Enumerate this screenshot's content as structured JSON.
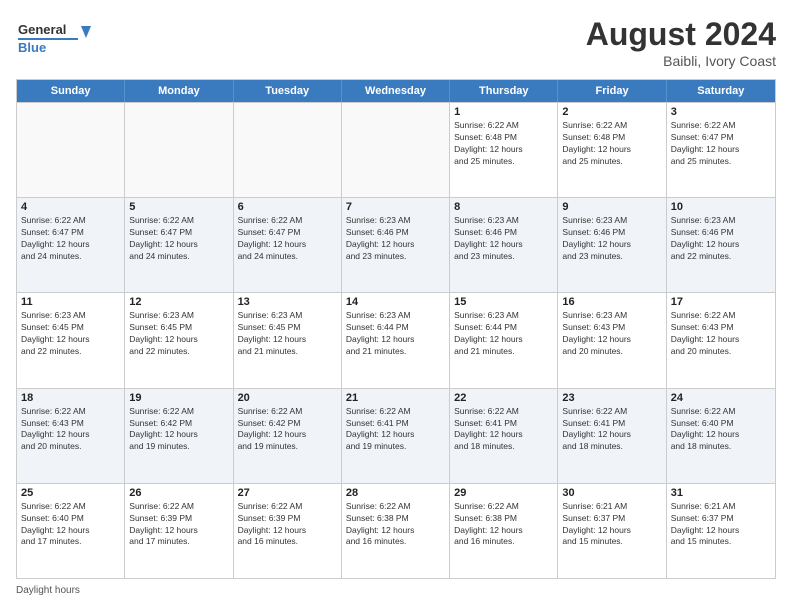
{
  "header": {
    "logo_line1": "General",
    "logo_line2": "Blue",
    "month_year": "August 2024",
    "location": "Baibli, Ivory Coast"
  },
  "calendar": {
    "days_of_week": [
      "Sunday",
      "Monday",
      "Tuesday",
      "Wednesday",
      "Thursday",
      "Friday",
      "Saturday"
    ],
    "rows": [
      [
        {
          "day": "",
          "info": "",
          "empty": true
        },
        {
          "day": "",
          "info": "",
          "empty": true
        },
        {
          "day": "",
          "info": "",
          "empty": true
        },
        {
          "day": "",
          "info": "",
          "empty": true
        },
        {
          "day": "1",
          "info": "Sunrise: 6:22 AM\nSunset: 6:48 PM\nDaylight: 12 hours\nand 25 minutes."
        },
        {
          "day": "2",
          "info": "Sunrise: 6:22 AM\nSunset: 6:48 PM\nDaylight: 12 hours\nand 25 minutes."
        },
        {
          "day": "3",
          "info": "Sunrise: 6:22 AM\nSunset: 6:47 PM\nDaylight: 12 hours\nand 25 minutes."
        }
      ],
      [
        {
          "day": "4",
          "info": "Sunrise: 6:22 AM\nSunset: 6:47 PM\nDaylight: 12 hours\nand 24 minutes."
        },
        {
          "day": "5",
          "info": "Sunrise: 6:22 AM\nSunset: 6:47 PM\nDaylight: 12 hours\nand 24 minutes."
        },
        {
          "day": "6",
          "info": "Sunrise: 6:22 AM\nSunset: 6:47 PM\nDaylight: 12 hours\nand 24 minutes."
        },
        {
          "day": "7",
          "info": "Sunrise: 6:23 AM\nSunset: 6:46 PM\nDaylight: 12 hours\nand 23 minutes."
        },
        {
          "day": "8",
          "info": "Sunrise: 6:23 AM\nSunset: 6:46 PM\nDaylight: 12 hours\nand 23 minutes."
        },
        {
          "day": "9",
          "info": "Sunrise: 6:23 AM\nSunset: 6:46 PM\nDaylight: 12 hours\nand 23 minutes."
        },
        {
          "day": "10",
          "info": "Sunrise: 6:23 AM\nSunset: 6:46 PM\nDaylight: 12 hours\nand 22 minutes."
        }
      ],
      [
        {
          "day": "11",
          "info": "Sunrise: 6:23 AM\nSunset: 6:45 PM\nDaylight: 12 hours\nand 22 minutes."
        },
        {
          "day": "12",
          "info": "Sunrise: 6:23 AM\nSunset: 6:45 PM\nDaylight: 12 hours\nand 22 minutes."
        },
        {
          "day": "13",
          "info": "Sunrise: 6:23 AM\nSunset: 6:45 PM\nDaylight: 12 hours\nand 21 minutes."
        },
        {
          "day": "14",
          "info": "Sunrise: 6:23 AM\nSunset: 6:44 PM\nDaylight: 12 hours\nand 21 minutes."
        },
        {
          "day": "15",
          "info": "Sunrise: 6:23 AM\nSunset: 6:44 PM\nDaylight: 12 hours\nand 21 minutes."
        },
        {
          "day": "16",
          "info": "Sunrise: 6:23 AM\nSunset: 6:43 PM\nDaylight: 12 hours\nand 20 minutes."
        },
        {
          "day": "17",
          "info": "Sunrise: 6:22 AM\nSunset: 6:43 PM\nDaylight: 12 hours\nand 20 minutes."
        }
      ],
      [
        {
          "day": "18",
          "info": "Sunrise: 6:22 AM\nSunset: 6:43 PM\nDaylight: 12 hours\nand 20 minutes."
        },
        {
          "day": "19",
          "info": "Sunrise: 6:22 AM\nSunset: 6:42 PM\nDaylight: 12 hours\nand 19 minutes."
        },
        {
          "day": "20",
          "info": "Sunrise: 6:22 AM\nSunset: 6:42 PM\nDaylight: 12 hours\nand 19 minutes."
        },
        {
          "day": "21",
          "info": "Sunrise: 6:22 AM\nSunset: 6:41 PM\nDaylight: 12 hours\nand 19 minutes."
        },
        {
          "day": "22",
          "info": "Sunrise: 6:22 AM\nSunset: 6:41 PM\nDaylight: 12 hours\nand 18 minutes."
        },
        {
          "day": "23",
          "info": "Sunrise: 6:22 AM\nSunset: 6:41 PM\nDaylight: 12 hours\nand 18 minutes."
        },
        {
          "day": "24",
          "info": "Sunrise: 6:22 AM\nSunset: 6:40 PM\nDaylight: 12 hours\nand 18 minutes."
        }
      ],
      [
        {
          "day": "25",
          "info": "Sunrise: 6:22 AM\nSunset: 6:40 PM\nDaylight: 12 hours\nand 17 minutes."
        },
        {
          "day": "26",
          "info": "Sunrise: 6:22 AM\nSunset: 6:39 PM\nDaylight: 12 hours\nand 17 minutes."
        },
        {
          "day": "27",
          "info": "Sunrise: 6:22 AM\nSunset: 6:39 PM\nDaylight: 12 hours\nand 16 minutes."
        },
        {
          "day": "28",
          "info": "Sunrise: 6:22 AM\nSunset: 6:38 PM\nDaylight: 12 hours\nand 16 minutes."
        },
        {
          "day": "29",
          "info": "Sunrise: 6:22 AM\nSunset: 6:38 PM\nDaylight: 12 hours\nand 16 minutes."
        },
        {
          "day": "30",
          "info": "Sunrise: 6:21 AM\nSunset: 6:37 PM\nDaylight: 12 hours\nand 15 minutes."
        },
        {
          "day": "31",
          "info": "Sunrise: 6:21 AM\nSunset: 6:37 PM\nDaylight: 12 hours\nand 15 minutes."
        }
      ]
    ]
  },
  "footer": {
    "note": "Daylight hours"
  }
}
